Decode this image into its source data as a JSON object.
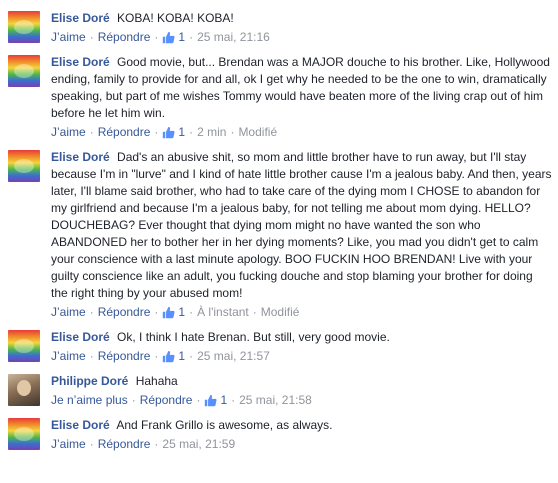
{
  "comments": [
    {
      "author": "Elise Doré",
      "text": "KOBA! KOBA! KOBA!",
      "like_label": "J’aime",
      "reply_label": "Répondre",
      "likes": "1",
      "timestamp": "25 mai, 21:16",
      "edited": ""
    },
    {
      "author": "Elise Doré",
      "text": "Good movie, but... Brendan was a MAJOR douche to his brother. Like, Hollywood ending, family to provide for and all, ok I get why he needed to be the one to win, dramatically speaking, but part of me wishes Tommy would have beaten more of the living crap out of him before he let him win.",
      "like_label": "J’aime",
      "reply_label": "Répondre",
      "likes": "1",
      "timestamp": "2 min",
      "edited": "Modifié"
    },
    {
      "author": "Elise Doré",
      "text": "Dad's an abusive shit, so mom and little brother have to run away, but I'll stay because I'm in \"lurve\" and I kind of hate little brother cause I'm a jealous baby. And then, years later, I'll blame said brother, who had to take care of the dying mom I CHOSE to abandon for my girlfriend and because I'm a jealous baby, for not telling me about mom dying. HELLO? DOUCHEBAG? Ever thought that dying mom might no have wanted the son who ABANDONED her to bother her in her dying moments? Like, you mad you didn't get to calm your conscience with a last minute apology. BOO FUCKIN HOO BRENDAN! Live with your guilty conscience like an adult, you fucking douche and stop blaming your brother for doing the right thing by your abused mom!",
      "like_label": "J’aime",
      "reply_label": "Répondre",
      "likes": "1",
      "timestamp": "À l'instant",
      "edited": "Modifié"
    },
    {
      "author": "Elise Doré",
      "text": "Ok, I think I hate Brenan. But still, very good movie.",
      "like_label": "J’aime",
      "reply_label": "Répondre",
      "likes": "1",
      "timestamp": "25 mai, 21:57",
      "edited": ""
    },
    {
      "author": "Philippe Doré",
      "text": "Hahaha",
      "like_label": "Je n’aime plus",
      "reply_label": "Répondre",
      "likes": "1",
      "timestamp": "25 mai, 21:58",
      "edited": ""
    },
    {
      "author": "Elise Doré",
      "text": "And Frank Grillo is awesome, as always.",
      "like_label": "J’aime",
      "reply_label": "Répondre",
      "likes": "",
      "timestamp": "25 mai, 21:59",
      "edited": ""
    }
  ],
  "icons": {
    "avatar_style": [
      "rainbow",
      "rainbow",
      "rainbow",
      "rainbow",
      "photo",
      "rainbow"
    ],
    "like": "thumbs-up-icon"
  },
  "colors": {
    "link": "#365899",
    "meta": "#90949c",
    "text": "#1d2129",
    "like_icon": "#5890ff"
  }
}
